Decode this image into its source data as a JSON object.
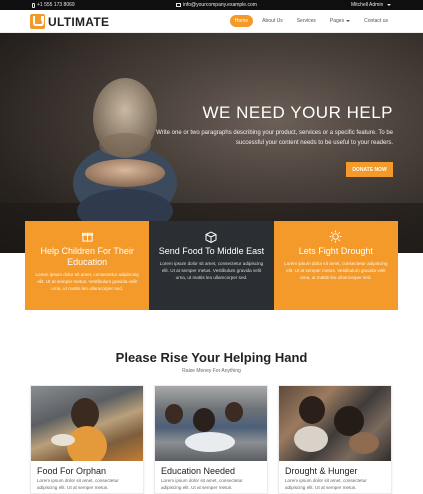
{
  "topbar": {
    "phone": "+1 555 173 8069",
    "email": "info@yourcompany.example.com",
    "user": "Mitchell Admin"
  },
  "header": {
    "logo_text": "ULTIMATE",
    "nav": [
      "Home",
      "About Us",
      "Services",
      "Pages",
      "Contact us"
    ]
  },
  "hero": {
    "title": "WE NEED YOUR HELP",
    "subtitle": "Write one or two paragraphs describing your product, services or a specific feature. To be successful your content needs to be useful to your readers.",
    "button": "DONATE NOW"
  },
  "features": [
    {
      "icon": "gift-icon",
      "title": "Help Children For Their Education",
      "text": "Lorem ipsum dolor sit amet, consectetur adipiscing elit. Ut at semper metus. Vestibulum gravida velit urna, ut mattis leo ullamcorper sed.",
      "color": "#f39a2b"
    },
    {
      "icon": "box-icon",
      "title": "Send Food To Middle East",
      "text": "Lorem ipsum dolor sit amet, consectetur adipiscing elit. Ut at semper metus. Vestibulum gravida velit urna, ut mattis leo ullamcorper sed.",
      "color": "#2b2f33"
    },
    {
      "icon": "sun-icon",
      "title": "Lets Fight Drought",
      "text": "Lorem ipsum dolor sit amet, consectetur adipiscing elit. Ut at semper metus. Vestibulum gravida velit urna, ut mattis leo ullamcorper sed.",
      "color": "#f39a2b"
    }
  ],
  "section": {
    "title": "Please Rise Your Helping Hand",
    "subtitle": "Raise Money For Anything"
  },
  "cards": [
    {
      "title": "Food For Orphan",
      "text": "Lorem ipsum dolor sit amet, consectetur adipiscing elit. Ut at semper metus."
    },
    {
      "title": "Education Needed",
      "text": "Lorem ipsum dolor sit amet, consectetur adipiscing elit. Ut at semper metus."
    },
    {
      "title": "Drought & Hunger",
      "text": "Lorem ipsum dolor sit amet, consectetur adipiscing elit. Ut at semper metus."
    }
  ],
  "colors": {
    "accent": "#f39a2b",
    "dark": "#2b2f33",
    "topbar": "#0f0f0f"
  }
}
